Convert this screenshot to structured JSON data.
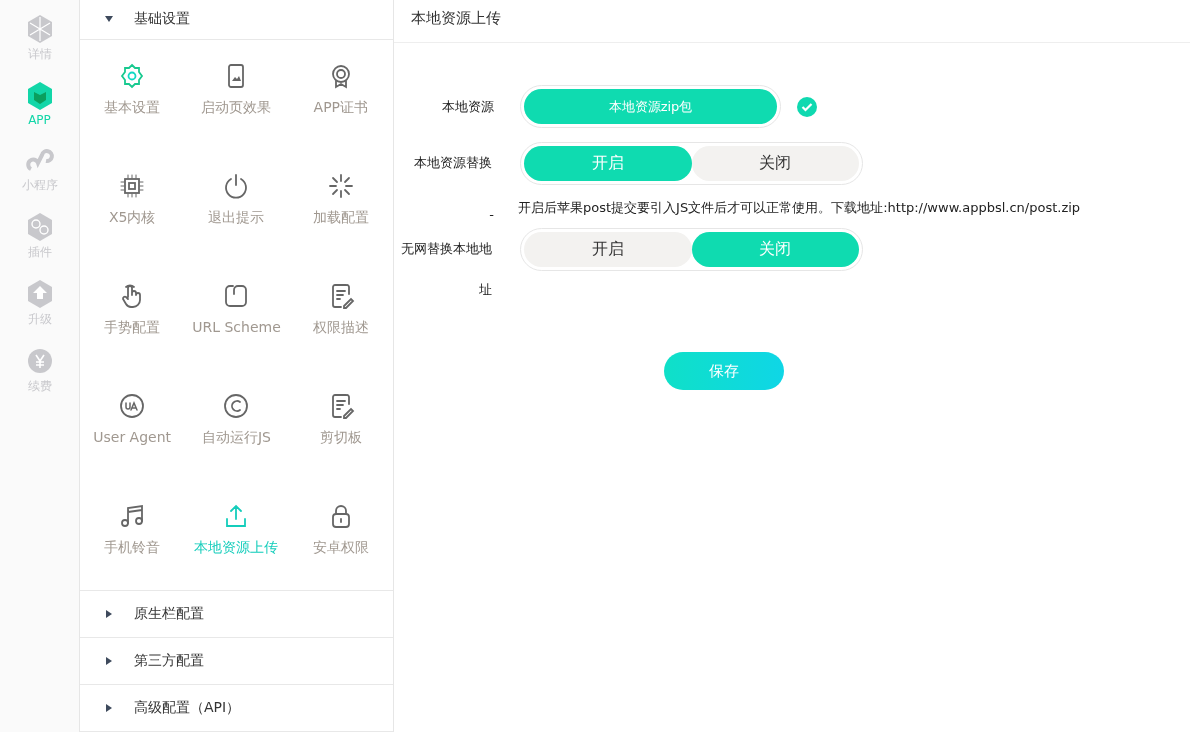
{
  "rail": [
    {
      "label": "详情",
      "selected": false
    },
    {
      "label": "APP",
      "selected": true
    },
    {
      "label": "小程序",
      "selected": false
    },
    {
      "label": "插件",
      "selected": false
    },
    {
      "label": "升级",
      "selected": false
    },
    {
      "label": "续费",
      "selected": false
    }
  ],
  "sections": [
    {
      "label": "基础设置",
      "expanded": true,
      "items": [
        {
          "label": "基本设置",
          "selected": false
        },
        {
          "label": "启动页效果",
          "selected": false
        },
        {
          "label": "APP证书",
          "selected": false
        },
        {
          "label": "X5内核",
          "selected": false
        },
        {
          "label": "退出提示",
          "selected": false
        },
        {
          "label": "加载配置",
          "selected": false
        },
        {
          "label": "手势配置",
          "selected": false
        },
        {
          "label": "URL Scheme",
          "selected": false
        },
        {
          "label": "权限描述",
          "selected": false
        },
        {
          "label": "User Agent",
          "selected": false
        },
        {
          "label": "自动运行JS",
          "selected": false
        },
        {
          "label": "剪切板",
          "selected": false
        },
        {
          "label": "手机铃音",
          "selected": false
        },
        {
          "label": "本地资源上传",
          "selected": true
        },
        {
          "label": "安卓权限",
          "selected": false
        }
      ]
    },
    {
      "label": "原生栏配置",
      "expanded": false
    },
    {
      "label": "第三方配置",
      "expanded": false
    },
    {
      "label": "高级配置（API）",
      "expanded": false
    }
  ],
  "page_title": "本地资源上传",
  "form": [
    {
      "kind": "upload",
      "label": "本地资源",
      "button": "本地资源zip包",
      "uploaded": true
    },
    {
      "kind": "toggle",
      "label": "本地资源替换",
      "options": [
        {
          "label": "开启",
          "selected": true
        },
        {
          "label": "关闭",
          "selected": false
        }
      ]
    },
    {
      "kind": "note",
      "label": "-",
      "text": "开启后苹果post提交要引入JS文件后才可以正常使用。下载地址:http://www.appbsl.cn/post.zip"
    },
    {
      "kind": "toggle",
      "label": "无网替换本地地址",
      "options": [
        {
          "label": "开启",
          "selected": false
        },
        {
          "label": "关闭",
          "selected": true
        }
      ]
    }
  ],
  "save_button": "保存"
}
